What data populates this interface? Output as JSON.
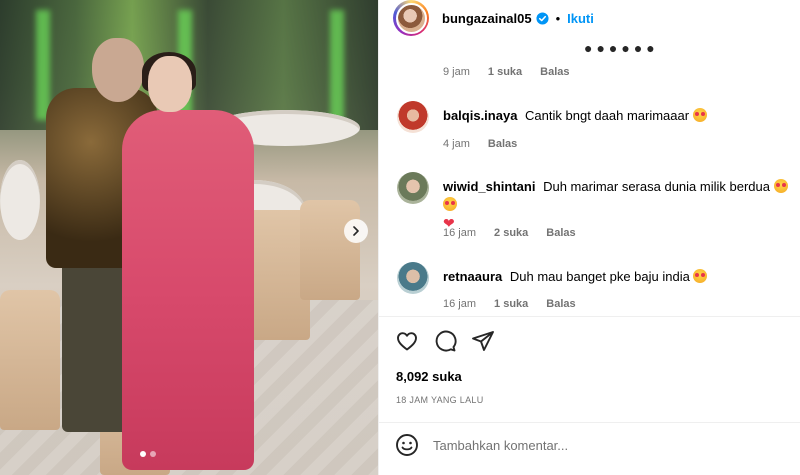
{
  "post": {
    "username": "bungazainal05",
    "follow_label": "Ikuti",
    "separator": "•",
    "likes": "8,092 suka",
    "time_ago": "18 JAM YANG LALU",
    "comment_placeholder": "Tambahkan komentar...",
    "carousel": {
      "total": 2,
      "current": 1
    }
  },
  "comments": {
    "prev_meta": {
      "time": "9 jam",
      "likes": "1 suka",
      "reply": "Balas"
    },
    "items": [
      {
        "user": "balqis.inaya",
        "text": "Cantik bngt daah marimaaar",
        "time": "4 jam",
        "likes": "",
        "reply": "Balas"
      },
      {
        "user": "wiwid_shintani",
        "text": "Duh marimar serasa dunia milik berdua",
        "time": "16 jam",
        "likes": "2 suka",
        "reply": "Balas"
      },
      {
        "user": "retnaaura",
        "text": "Duh mau banget pke baju india",
        "time": "16 jam",
        "likes": "1 suka",
        "reply": "Balas"
      }
    ]
  },
  "icons": {
    "verified": "verified-badge-icon",
    "next": "chevron-right-icon",
    "like": "heart-outline-icon",
    "comment": "comment-bubble-icon",
    "share": "paper-plane-icon",
    "emoji": "emoji-smile-icon"
  },
  "colors": {
    "link": "#0095f6",
    "muted": "#737373",
    "verified": "#0095f6"
  }
}
